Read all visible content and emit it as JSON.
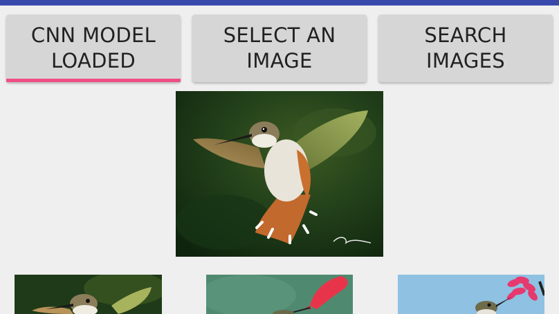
{
  "app_bar": {
    "color": "#3949ab"
  },
  "buttons": {
    "cnn_model": {
      "label": "CNN MODEL\nLOADED",
      "indicator_color": "#ef4f86"
    },
    "select_image": {
      "label": "SELECT AN\nIMAGE"
    },
    "search_images": {
      "label": "SEARCH\nIMAGES"
    }
  },
  "selected_image": {
    "icon": "hummingbird-photo"
  },
  "results": [
    {
      "icon": "hummingbird-photo"
    },
    {
      "icon": "hummingbird-feeder-photo"
    },
    {
      "icon": "hummingbird-flower-photo"
    }
  ]
}
